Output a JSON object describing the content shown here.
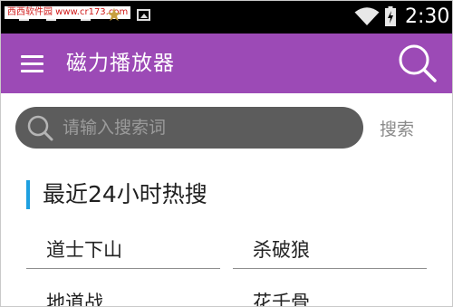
{
  "status_bar": {
    "watermark": "西西软件园 www.cr173.com",
    "time": "2:30",
    "icons": [
      "notification-icon",
      "star-icon",
      "image-icon",
      "wifi-icon",
      "battery-charging-icon"
    ]
  },
  "toolbar": {
    "title": "磁力播放器",
    "menu_icon": "menu-icon",
    "search_icon": "search-icon",
    "color": "#9c4ab6"
  },
  "search": {
    "placeholder": "请输入搜索词",
    "value": "",
    "button_label": "搜索"
  },
  "hot_section": {
    "title": "最近24小时热搜",
    "accent": "#1ea0e0",
    "items": [
      {
        "label": "道士下山"
      },
      {
        "label": "杀破狼"
      },
      {
        "label": "地道战"
      },
      {
        "label": "花千骨"
      }
    ]
  }
}
